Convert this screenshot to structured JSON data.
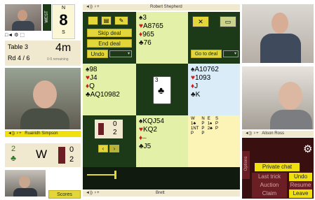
{
  "top_left": {
    "tag": "WEST",
    "n_label": "N",
    "board_number": "8",
    "s_label": "S",
    "icons_row": "□◄ ⚙ ⬚"
  },
  "table_info": {
    "table": "Table 3",
    "round": "Rd 4 / 6",
    "time": "4m",
    "time_sub": "0-5 remaining"
  },
  "north_bar": {
    "icons": "◄)) ♀+",
    "name": "Robert Shepherd"
  },
  "west_bar": {
    "icons": "◄)) ♀+",
    "name": "Ruairidh Simpson"
  },
  "east_bar": {
    "icons": "◄)) ♀+",
    "name": "Alison Ross"
  },
  "south_bar": {
    "icons": "◄)) ♀+",
    "name": "Brett"
  },
  "controls": {
    "skip_deal": "Skip deal",
    "end_deal": "End deal",
    "undo": "Undo",
    "go_to_deal": "Go to deal"
  },
  "north_hand": {
    "spades": "3",
    "hearts": "A8765",
    "diamonds": "965",
    "clubs": "76"
  },
  "west_hand": {
    "spades": "98",
    "hearts": "J4",
    "diamonds": "Q",
    "clubs": "AQ10982"
  },
  "east_hand": {
    "spades": "A10762",
    "hearts": "1093",
    "diamonds": "J",
    "clubs": "K"
  },
  "south_hand": {
    "spades": "KQJ54",
    "hearts": "KQ2",
    "diamonds": "–",
    "clubs": "J5"
  },
  "played_card": {
    "rank": "3",
    "suit": "♣"
  },
  "tricks_ew": {
    "won": "0",
    "lost": "2"
  },
  "contract": {
    "level": "2",
    "suit": "♣",
    "declarer": "W",
    "tricks_won": "0",
    "tricks_lost": "2"
  },
  "auction": {
    "headers": [
      "W",
      "N",
      "E",
      "S"
    ],
    "rows": [
      [
        "1♣",
        "P",
        "1♠",
        "P"
      ],
      [
        "1NT",
        "P",
        "2♣",
        "P"
      ],
      [
        "P",
        "P",
        "",
        ""
      ]
    ]
  },
  "right_panel": {
    "side_tab": "Options",
    "private_chat": "Private chat",
    "buttons": [
      {
        "label": "Last trick",
        "style": "dark"
      },
      {
        "label": "Undo",
        "style": "yellow"
      },
      {
        "label": "Auction",
        "style": "dark"
      },
      {
        "label": "Resume",
        "style": "dark"
      },
      {
        "label": "Claim",
        "style": "dark"
      },
      {
        "label": "Leave",
        "style": "yellow"
      }
    ]
  },
  "scores_label": "Scores",
  "colors": {
    "panel_green": "#e2f0a8",
    "dark_green": "#1c3a18",
    "button_yellow": "#e3d63a",
    "panel_blue": "#d9ecf7",
    "dark_red": "#6b1f24"
  }
}
